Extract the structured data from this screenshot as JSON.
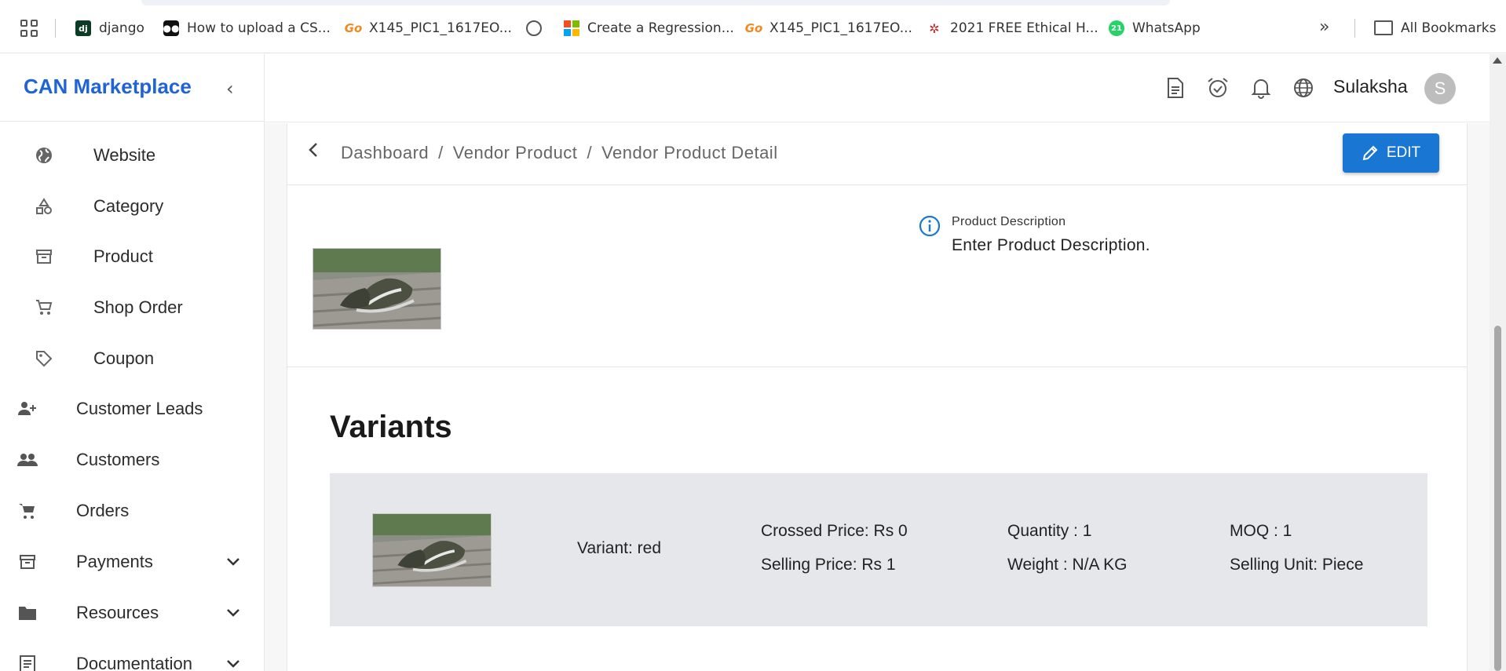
{
  "bookmarks": {
    "items": [
      {
        "label": "django",
        "icon": "django-favicon"
      },
      {
        "label": "How to upload a CS...",
        "icon": "medium-favicon"
      },
      {
        "label": "X145_PIC1_1617EO...",
        "icon": "go-favicon"
      },
      {
        "label": "",
        "icon": "globe-favicon"
      },
      {
        "label": "Create a Regression...",
        "icon": "microsoft-favicon"
      },
      {
        "label": "X145_PIC1_1617EO...",
        "icon": "go-favicon"
      },
      {
        "label": "2021 FREE Ethical H...",
        "icon": "ethical-hacking-favicon"
      },
      {
        "label": "WhatsApp",
        "icon": "whatsapp-favicon"
      }
    ],
    "more": "»",
    "all_bookmarks": "All Bookmarks"
  },
  "sidebar": {
    "brand": "CAN Marketplace",
    "collapse_icon": "‹",
    "items": [
      {
        "label": "Website",
        "icon": "globe-icon"
      },
      {
        "label": "Category",
        "icon": "shapes-icon"
      },
      {
        "label": "Product",
        "icon": "archive-icon"
      },
      {
        "label": "Shop Order",
        "icon": "cart-icon"
      },
      {
        "label": "Coupon",
        "icon": "tag-icon"
      },
      {
        "label": "Customer Leads",
        "icon": "person-add-icon"
      },
      {
        "label": "Customers",
        "icon": "people-icon"
      },
      {
        "label": "Orders",
        "icon": "cart-icon"
      },
      {
        "label": "Payments",
        "icon": "archive-icon"
      },
      {
        "label": "Resources",
        "icon": "folder-icon"
      },
      {
        "label": "Documentation",
        "icon": "document-icon"
      }
    ],
    "chevron": "⌄"
  },
  "header": {
    "username": "Sulaksha",
    "avatar_initial": "S"
  },
  "breadcrumb": {
    "back_icon": "‹",
    "items": [
      "Dashboard",
      "/",
      "Vendor Product",
      "/",
      "Vendor Product Detail"
    ],
    "edit_label": "EDIT"
  },
  "product": {
    "description_label": "Product Description",
    "description_value": "Enter Product Description."
  },
  "variants": {
    "title": "Variants",
    "items": [
      {
        "variant": "Variant: red",
        "crossed_price": "Crossed Price: Rs 0",
        "selling_price": "Selling Price: Rs 1",
        "quantity": "Quantity : 1",
        "weight": "Weight : N/A KG",
        "moq": "MOQ : 1",
        "selling_unit": "Selling Unit: Piece"
      }
    ]
  },
  "colors": {
    "brand": "#1f63d8",
    "primary_button": "#1976d2",
    "variant_card": "#e6e7ea"
  }
}
